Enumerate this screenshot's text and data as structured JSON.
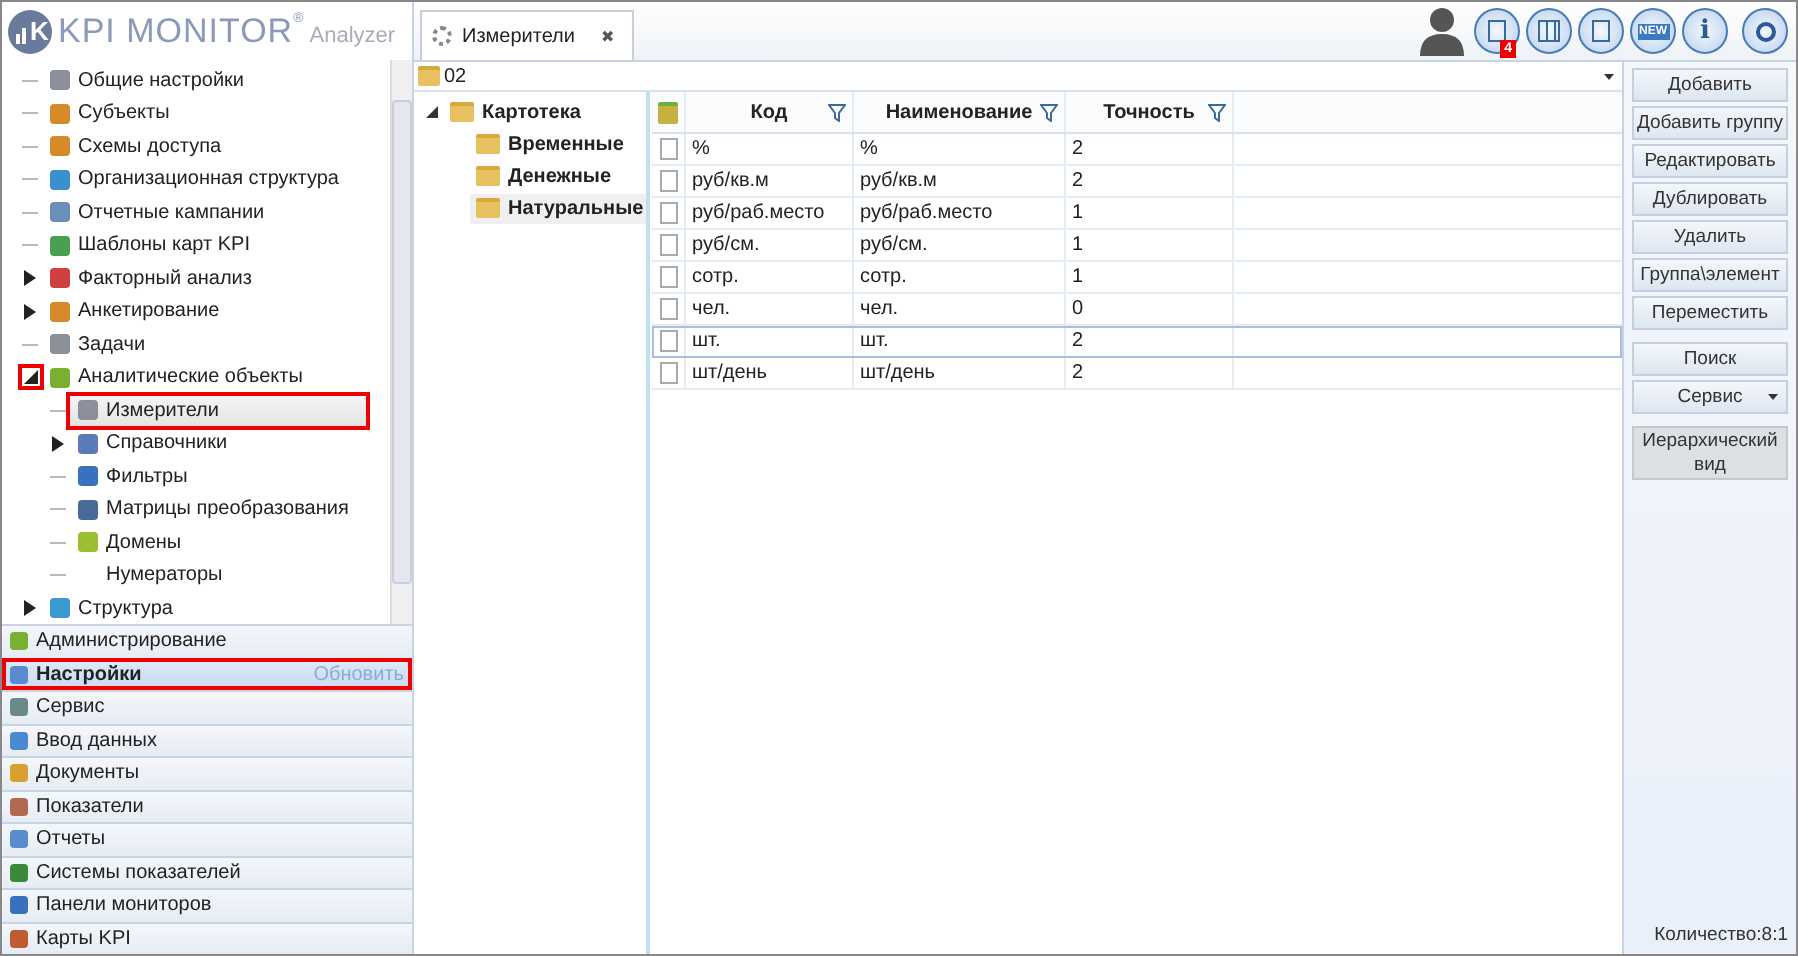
{
  "logo": {
    "mark": "K",
    "name": "KPI MONITOR",
    "registered": "®",
    "suffix": "Analyzer"
  },
  "nav_tree": [
    {
      "label": "Общие настройки",
      "selected": false,
      "highlighted": false
    },
    {
      "label": "Субъекты",
      "selected": false,
      "highlighted": false
    },
    {
      "label": "Схемы доступа",
      "selected": false,
      "highlighted": false
    },
    {
      "label": "Организационная структура",
      "selected": false,
      "highlighted": false
    },
    {
      "label": "Отчетные кампании",
      "selected": false,
      "highlighted": false
    },
    {
      "label": "Шаблоны карт KPI",
      "selected": false,
      "highlighted": false
    },
    {
      "label": "Факторный анализ",
      "expanded": false,
      "toggle_highlighted": false,
      "selected": false,
      "highlighted": false
    },
    {
      "label": "Анкетирование",
      "expanded": false,
      "toggle_highlighted": false,
      "selected": false,
      "highlighted": false
    },
    {
      "label": "Задачи",
      "selected": false,
      "highlighted": false
    },
    {
      "label": "Аналитические объекты",
      "expanded": true,
      "toggle_highlighted": true,
      "selected": false,
      "highlighted": false,
      "children": [
        {
          "label": "Измерители",
          "selected": true,
          "highlighted": true
        },
        {
          "label": "Справочники",
          "expanded": false,
          "toggle_highlighted": false,
          "selected": false,
          "highlighted": false
        },
        {
          "label": "Фильтры",
          "selected": false,
          "highlighted": false
        },
        {
          "label": "Матрицы преобразования",
          "selected": false,
          "highlighted": false
        },
        {
          "label": "Домены",
          "selected": false,
          "highlighted": false
        },
        {
          "label": "Нумераторы",
          "selected": false,
          "highlighted": false
        }
      ]
    },
    {
      "label": "Структура",
      "expanded": false,
      "toggle_highlighted": false,
      "selected": false,
      "highlighted": false
    }
  ],
  "sections": [
    {
      "label": "Администрирование",
      "selected": false,
      "annotation": false
    },
    {
      "label": "Настройки",
      "selected": true,
      "annotation": true,
      "action": "Обновить"
    },
    {
      "label": "Сервис",
      "selected": false,
      "annotation": false
    },
    {
      "label": "Ввод данных",
      "selected": false,
      "annotation": false
    },
    {
      "label": "Документы",
      "selected": false,
      "annotation": false
    },
    {
      "label": "Показатели",
      "selected": false,
      "annotation": false
    },
    {
      "label": "Отчеты",
      "selected": false,
      "annotation": false
    },
    {
      "label": "Системы показателей",
      "selected": false,
      "annotation": false
    },
    {
      "label": "Панели мониторов",
      "selected": false,
      "annotation": false
    },
    {
      "label": "Карты KPI",
      "selected": false,
      "annotation": false
    }
  ],
  "tabs": [
    {
      "label": "Измерители",
      "close": "✖",
      "selected": true
    }
  ],
  "toolbar": {
    "badge": "4",
    "new_label": "NEW",
    "info_label": "i"
  },
  "path": "02",
  "folders": [
    {
      "label": "Картотека",
      "expanded": true,
      "selected": false,
      "children": [
        {
          "label": "Временные",
          "selected": false
        },
        {
          "label": "Денежные",
          "selected": false
        },
        {
          "label": "Натуральные",
          "selected": true
        }
      ]
    }
  ],
  "table": {
    "columns": [
      "Код",
      "Наименование",
      "Точность"
    ],
    "rows": [
      {
        "cells": [
          "%",
          "%",
          "2"
        ],
        "selected": false
      },
      {
        "cells": [
          "руб/кв.м",
          "руб/кв.м",
          "2"
        ],
        "selected": false
      },
      {
        "cells": [
          "руб/раб.место",
          "руб/раб.место",
          "1"
        ],
        "selected": false
      },
      {
        "cells": [
          "руб/см.",
          "руб/см.",
          "1"
        ],
        "selected": false
      },
      {
        "cells": [
          "сотр.",
          "сотр.",
          "1"
        ],
        "selected": false
      },
      {
        "cells": [
          "чел.",
          "чел.",
          "0"
        ],
        "selected": false
      },
      {
        "cells": [
          "шт.",
          "шт.",
          "2"
        ],
        "selected": true
      },
      {
        "cells": [
          "шт/день",
          "шт/день",
          "2"
        ],
        "selected": false
      }
    ]
  },
  "actions": [
    [
      {
        "label": "Добавить",
        "kind": "button",
        "pressed": false
      },
      {
        "label": "Добавить группу",
        "kind": "button",
        "pressed": false
      },
      {
        "label": "Редактировать",
        "kind": "button",
        "pressed": false
      },
      {
        "label": "Дублировать",
        "kind": "button",
        "pressed": false
      },
      {
        "label": "Удалить",
        "kind": "button",
        "pressed": false
      },
      {
        "label": "Группа\\элемент",
        "kind": "button",
        "pressed": false
      },
      {
        "label": "Переместить",
        "kind": "button",
        "pressed": false
      }
    ],
    [
      {
        "label": "Поиск",
        "kind": "button",
        "pressed": false
      },
      {
        "label": "Сервис",
        "kind": "menu",
        "pressed": false
      }
    ],
    [
      {
        "label": "Иерархический вид",
        "kind": "button",
        "pressed": true
      }
    ]
  ],
  "status": "Количество:8:1"
}
